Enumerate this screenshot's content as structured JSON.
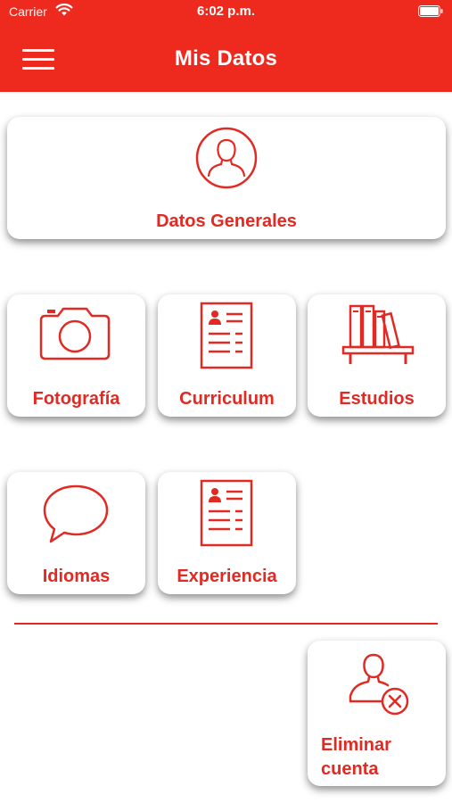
{
  "status_bar": {
    "carrier": "Carrier",
    "time": "6:02 p.m."
  },
  "header": {
    "title": "Mis Datos",
    "menu_icon": "hamburger-menu-icon",
    "background_color": "#ee2a1e"
  },
  "accent_color": "#e12a23",
  "cards": {
    "datos_generales": {
      "label": "Datos Generales",
      "icon": "user-circle-icon"
    },
    "fotografia": {
      "label": "Fotografía",
      "icon": "camera-icon"
    },
    "curriculum": {
      "label": "Curriculum",
      "icon": "resume-document-icon"
    },
    "estudios": {
      "label": "Estudios",
      "icon": "bookshelf-icon"
    },
    "idiomas": {
      "label": "Idiomas",
      "icon": "speech-bubble-icon"
    },
    "experiencia": {
      "label": "Experiencia",
      "icon": "resume-document-icon"
    },
    "eliminar_cuenta": {
      "label_line1": "Eliminar",
      "label_line2": "cuenta",
      "icon": "remove-user-icon"
    }
  }
}
